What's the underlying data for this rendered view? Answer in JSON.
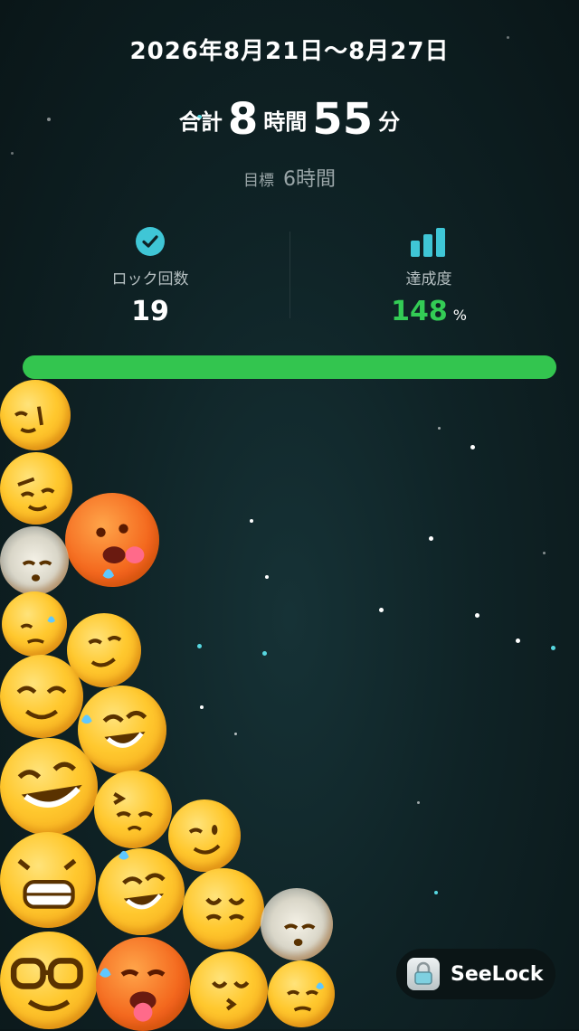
{
  "header": {
    "date_range": "2026年8月21日〜8月27日"
  },
  "total": {
    "prefix": "合計",
    "hours": "8",
    "hours_unit": "時間",
    "minutes": "55",
    "minutes_unit": "分"
  },
  "goal": {
    "label": "目標",
    "value": "6時間"
  },
  "stats": {
    "lock_count": {
      "label": "ロック回数",
      "value": "19",
      "icon": "check-circle-icon"
    },
    "achievement": {
      "label": "達成度",
      "value": "148",
      "unit": "%",
      "icon": "bar-chart-icon"
    }
  },
  "progress": {
    "fraction": 1.0
  },
  "colors": {
    "accent_cyan": "#3fc6d6",
    "accent_green": "#33cc55"
  },
  "emojis": [
    "sleepy-face",
    "smiling-face",
    "hot-face",
    "exhale-face",
    "sweat-face",
    "grinning-face",
    "nerd-face"
  ],
  "branding": {
    "app_name": "SeeLock",
    "icon": "lock-icon"
  }
}
